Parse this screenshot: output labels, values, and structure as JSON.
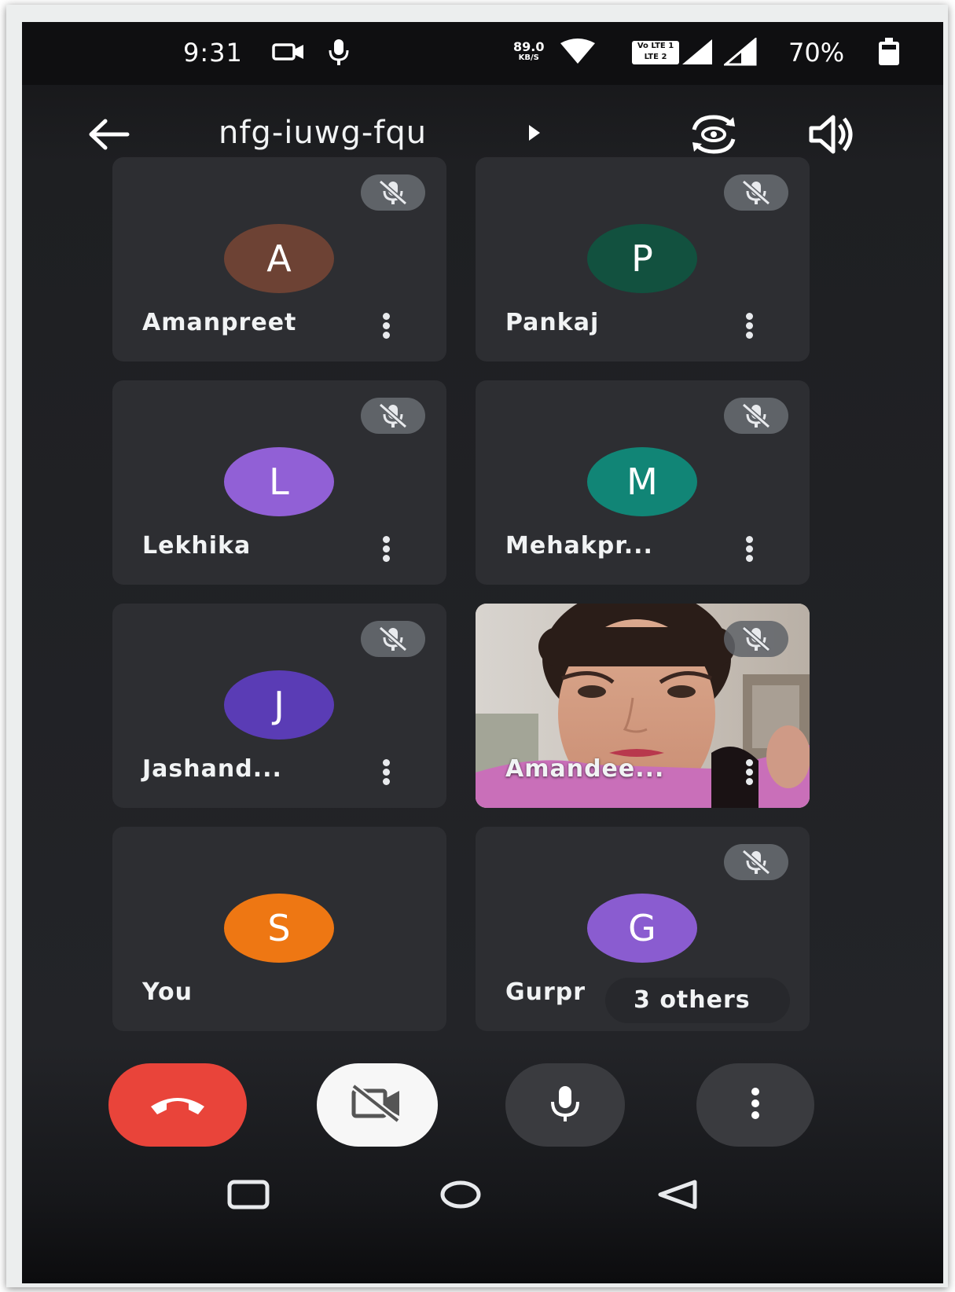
{
  "status_bar": {
    "time": "9:31",
    "net_speed_value": "89.0",
    "net_speed_unit": "KB/S",
    "volte_line1": "Vo LTE 1",
    "volte_line2": "LTE 2",
    "battery": "70%"
  },
  "meeting": {
    "code": "nfg-iuwg-fqu"
  },
  "participants": [
    {
      "initial": "A",
      "name": "Amanpreet",
      "color": "#6d4234",
      "muted": true
    },
    {
      "initial": "P",
      "name": "Pankaj",
      "color": "#12513f",
      "muted": true
    },
    {
      "initial": "L",
      "name": "Lekhika",
      "color": "#9160d6",
      "muted": true
    },
    {
      "initial": "M",
      "name": "Mehakpr...",
      "color": "#118576",
      "muted": true
    },
    {
      "initial": "J",
      "name": "Jashand...",
      "color": "#5a3cb5",
      "muted": true
    },
    {
      "initial": "",
      "name": "Amandee...",
      "color": "",
      "muted": true,
      "video": true
    },
    {
      "initial": "S",
      "name": "You",
      "color": "#ee7713",
      "muted": false
    },
    {
      "initial": "G",
      "name": "Gurpr",
      "color": "#8a5cd0",
      "muted": true
    }
  ],
  "others_chip": "3 others",
  "controls": {
    "end_call_icon": "phone-hangup-icon",
    "camera_icon": "video-off-icon",
    "mic_icon": "mic-icon",
    "more_icon": "more-vertical-icon"
  },
  "nav": [
    "recents-icon",
    "home-icon",
    "back-icon"
  ]
}
